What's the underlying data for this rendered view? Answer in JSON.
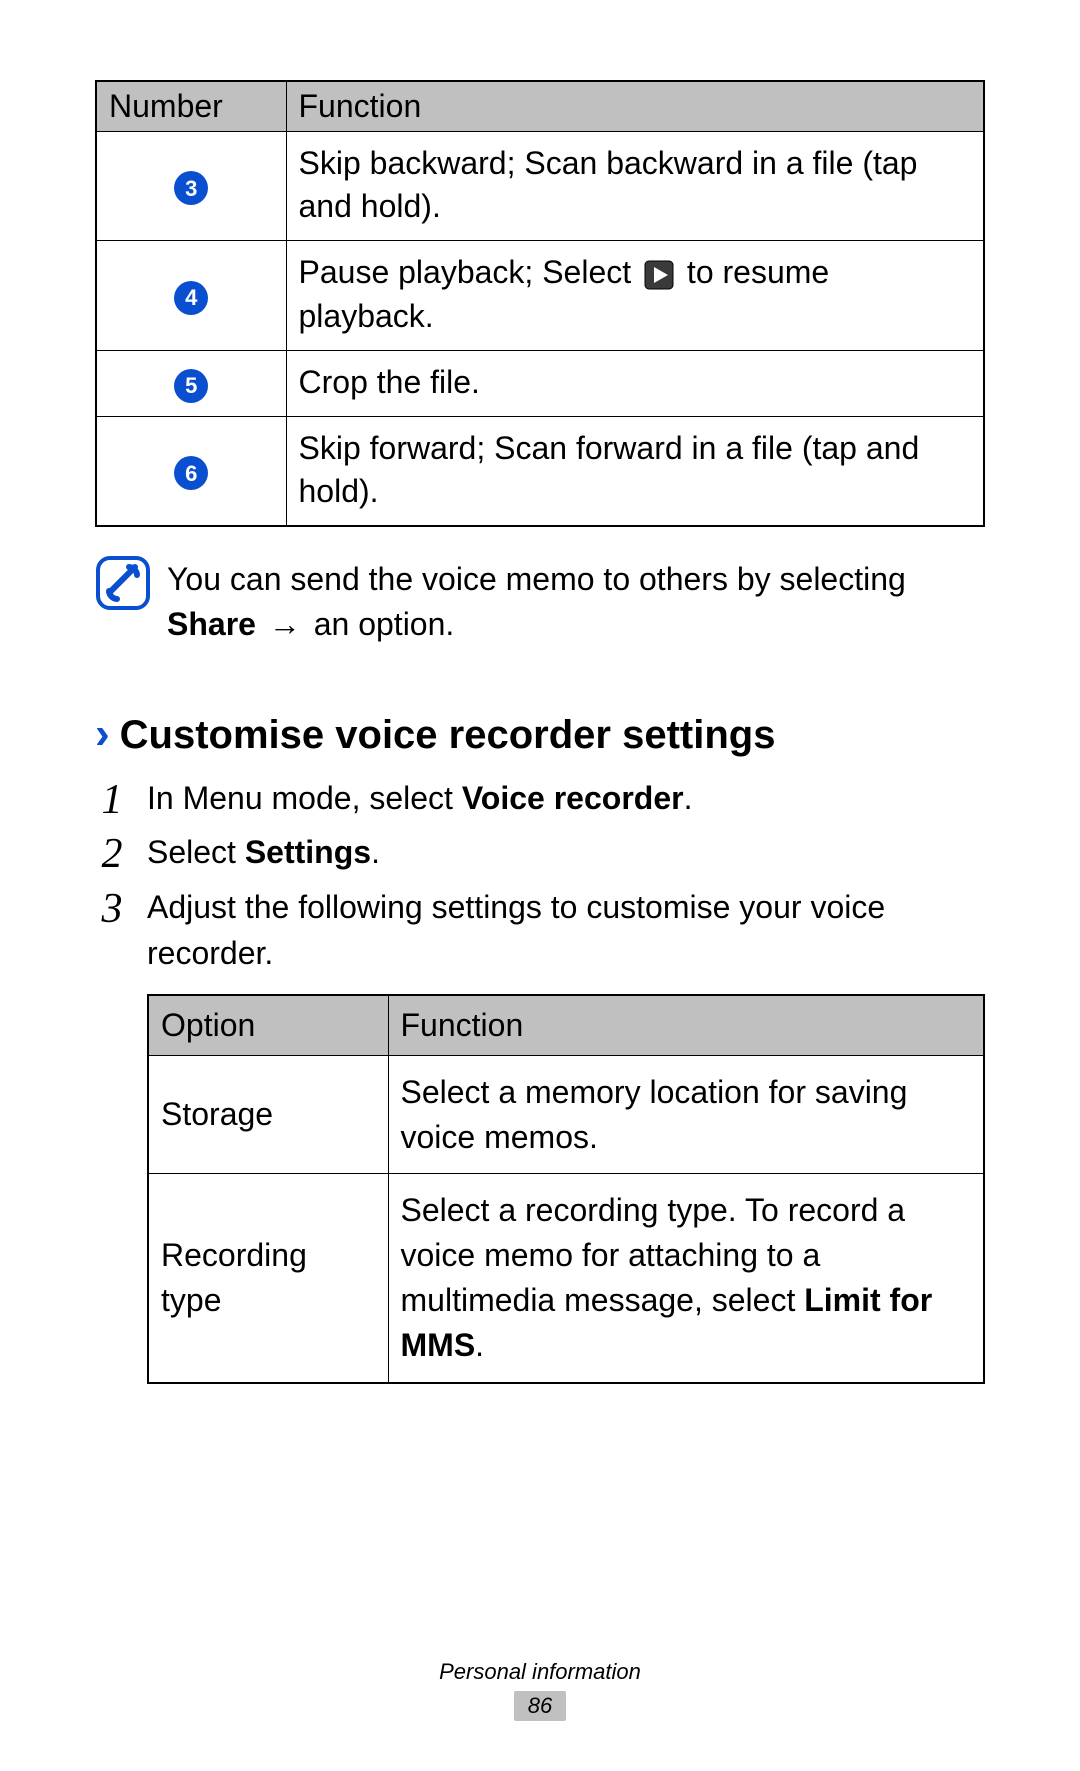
{
  "table1": {
    "headers": {
      "number": "Number",
      "function": "Function"
    },
    "rows": [
      {
        "num": "3",
        "desc": "Skip backward; Scan backward in a file (tap and hold)."
      },
      {
        "num": "4",
        "desc_pre": "Pause playback; Select ",
        "desc_post": " to resume playback."
      },
      {
        "num": "5",
        "desc": "Crop the file."
      },
      {
        "num": "6",
        "desc": "Skip forward; Scan forward in a file (tap and hold)."
      }
    ]
  },
  "note": {
    "text_pre": "You can send the voice memo to others by selecting ",
    "bold": "Share",
    "arrow": "→",
    "text_post": " an option."
  },
  "section": {
    "title": "Customise voice recorder settings"
  },
  "steps": [
    {
      "num": "1",
      "pre": "In Menu mode, select ",
      "bold": "Voice recorder",
      "post": "."
    },
    {
      "num": "2",
      "pre": "Select ",
      "bold": "Settings",
      "post": "."
    },
    {
      "num": "3",
      "pre": "Adjust the following settings to customise your voice recorder.",
      "bold": "",
      "post": ""
    }
  ],
  "table2": {
    "headers": {
      "option": "Option",
      "function": "Function"
    },
    "rows": [
      {
        "option": "Storage",
        "desc": "Select a memory location for saving voice memos."
      },
      {
        "option": "Recording type",
        "desc_pre": "Select a recording type. To record a voice memo for attaching to a multimedia message, select ",
        "bold": "Limit for MMS",
        "post": "."
      }
    ]
  },
  "footer": {
    "label": "Personal information",
    "page": "86"
  }
}
